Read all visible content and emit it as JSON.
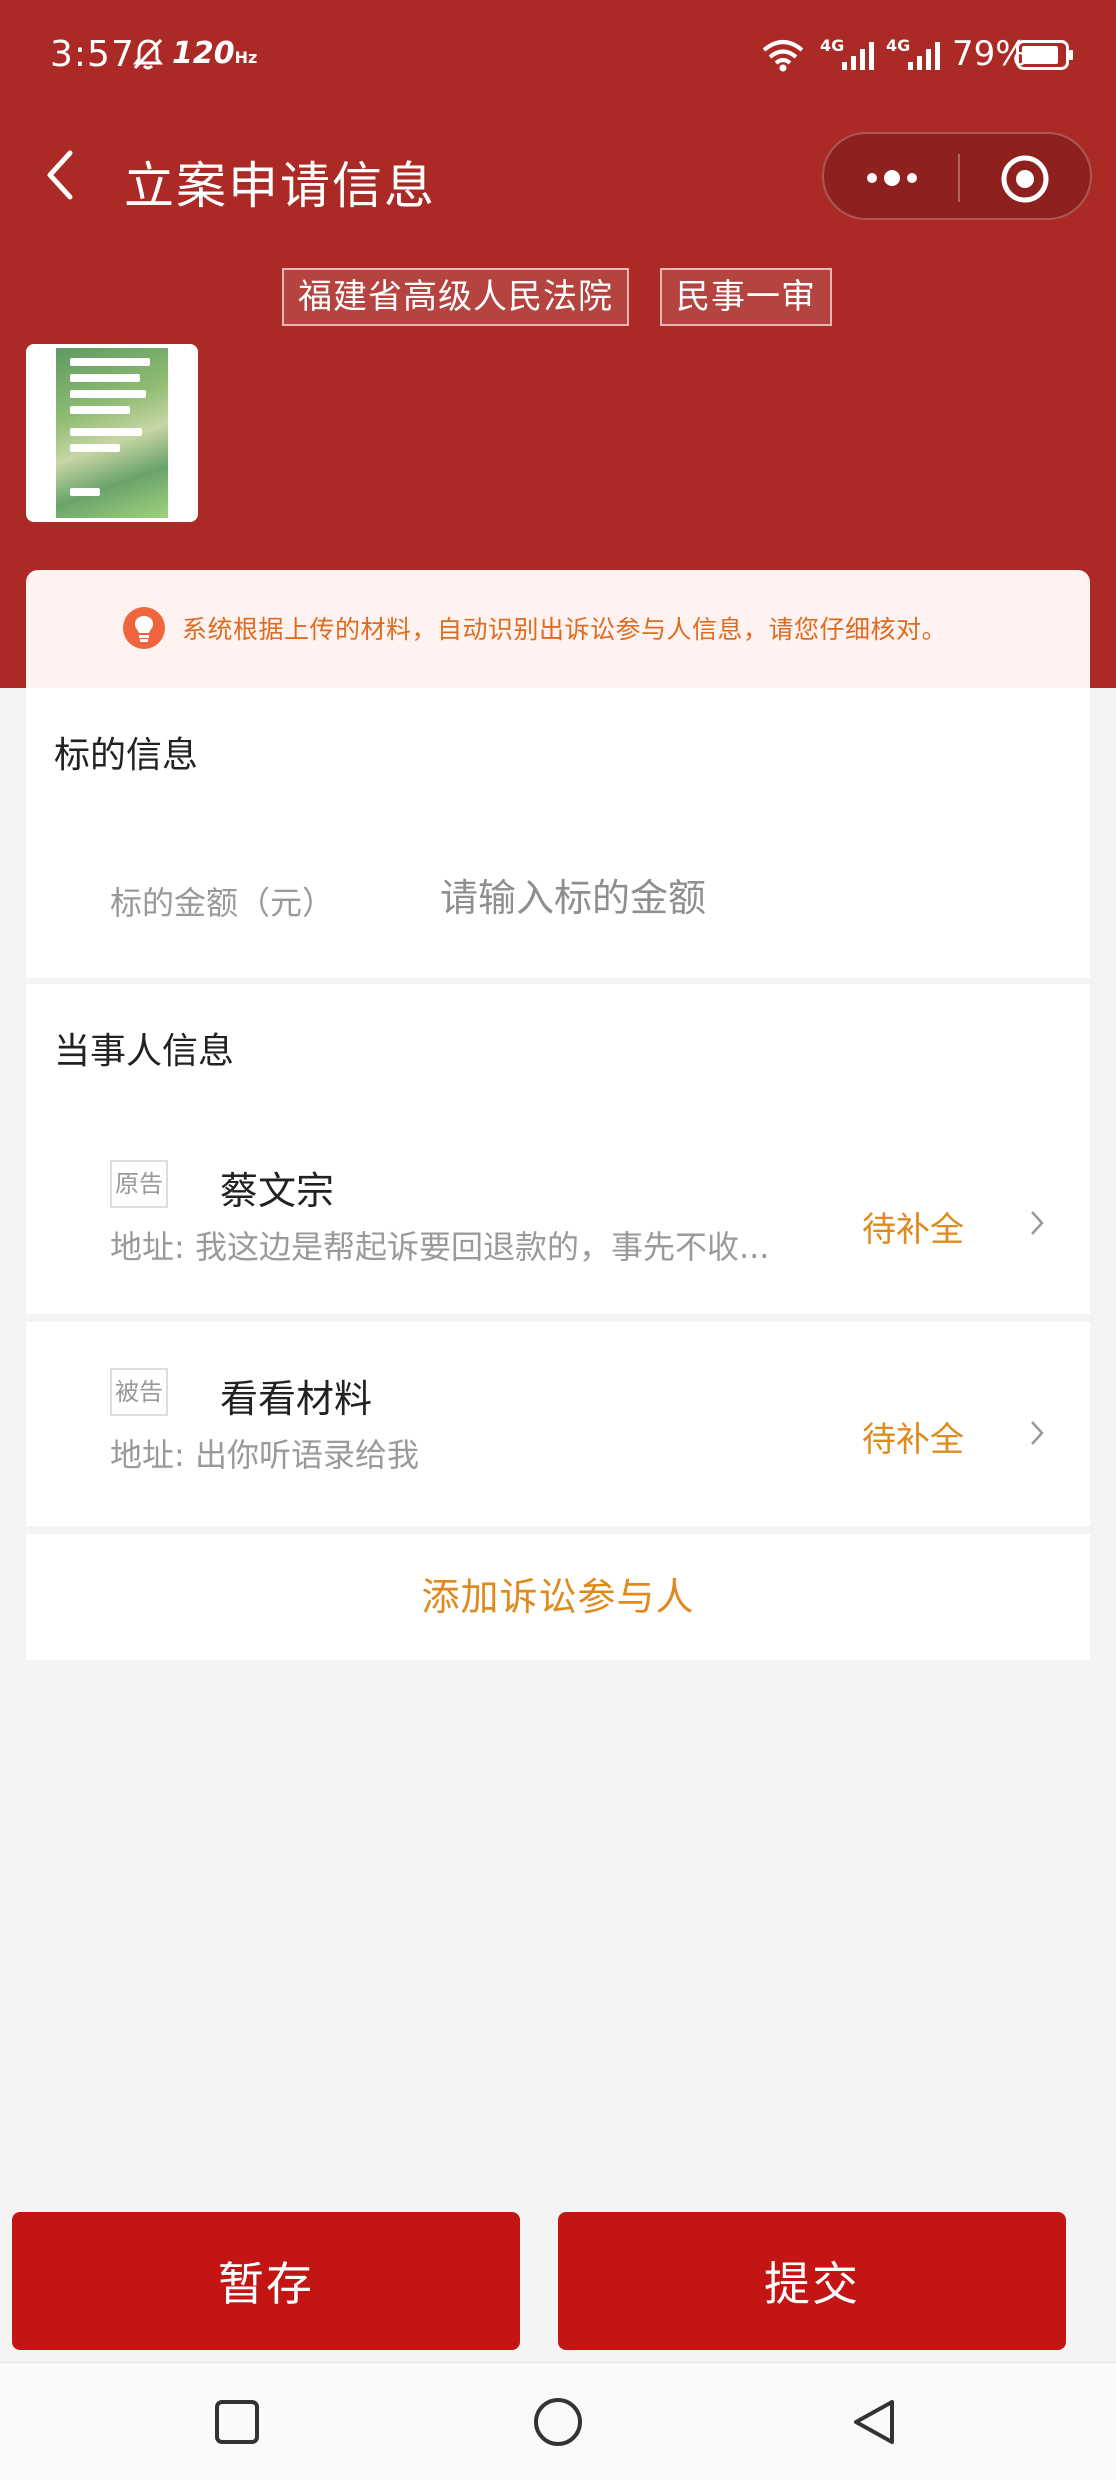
{
  "status_bar": {
    "time": "3:57",
    "refresh_rate": "120",
    "refresh_unit": "Hz",
    "network1": "4G",
    "network2": "4G",
    "battery": "79%"
  },
  "header": {
    "title": "立案申请信息",
    "tags": [
      "福建省高级人民法院",
      "民事一审"
    ],
    "accent_color": "#ab2a25"
  },
  "notice": {
    "text": "系统根据上传的材料，自动识别出诉讼参与人信息，请您仔细核对。"
  },
  "subject": {
    "section_title": "标的信息",
    "amount_label": "标的金额（元）",
    "amount_placeholder": "请输入标的金额",
    "amount_value": ""
  },
  "parties": {
    "section_title": "当事人信息",
    "items": [
      {
        "role": "原告",
        "name": "蔡文宗",
        "address": "地址: 我这边是帮起诉要回退款的，事先不收...",
        "status": "待补全"
      },
      {
        "role": "被告",
        "name": "看看材料",
        "address": "地址: 出你听语录给我",
        "status": "待补全"
      }
    ],
    "add_label": "添加诉讼参与人"
  },
  "footer": {
    "save_label": "暂存",
    "submit_label": "提交",
    "button_color": "#c41515"
  }
}
